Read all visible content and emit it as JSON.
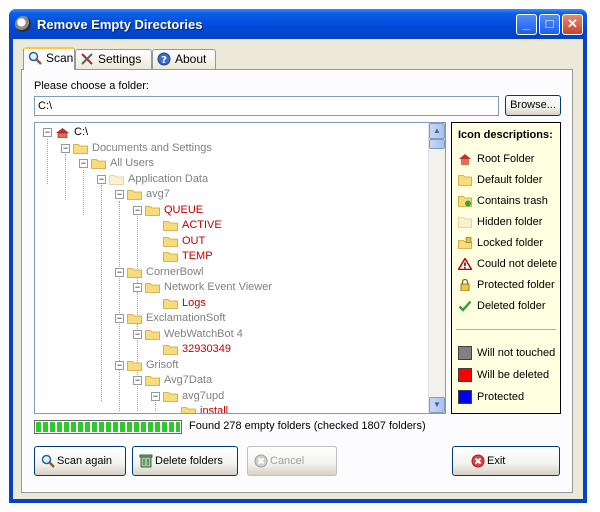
{
  "window": {
    "title": "Remove Empty Directories",
    "controls": {
      "minimize": "_",
      "maximize": "□",
      "close": "✕"
    }
  },
  "tabs": [
    {
      "label": "Scan",
      "icon": "magnifier-icon",
      "active": true
    },
    {
      "label": "Settings",
      "icon": "tools-icon",
      "active": false
    },
    {
      "label": "About",
      "icon": "help-icon",
      "active": false
    }
  ],
  "scan": {
    "folder_label": "Please choose a folder:",
    "folder_value": "C:\\",
    "browse_label": "Browse...",
    "tree": [
      {
        "label": "C:\\",
        "level": 0,
        "color": "black",
        "icon": "root"
      },
      {
        "label": "Documents and Settings",
        "level": 1,
        "color": "gray",
        "icon": "default"
      },
      {
        "label": "All Users",
        "level": 2,
        "color": "gray",
        "icon": "default"
      },
      {
        "label": "Application Data",
        "level": 3,
        "color": "gray",
        "icon": "hidden"
      },
      {
        "label": "avg7",
        "level": 4,
        "color": "gray",
        "icon": "default"
      },
      {
        "label": "QUEUE",
        "level": 5,
        "color": "red",
        "icon": "default"
      },
      {
        "label": "ACTIVE",
        "level": 6,
        "color": "red",
        "icon": "default",
        "leaf": true
      },
      {
        "label": "OUT",
        "level": 6,
        "color": "red",
        "icon": "default",
        "leaf": true
      },
      {
        "label": "TEMP",
        "level": 6,
        "color": "red",
        "icon": "default",
        "leaf": true
      },
      {
        "label": "CornerBowl",
        "level": 4,
        "color": "gray",
        "icon": "default"
      },
      {
        "label": "Network Event Viewer",
        "level": 5,
        "color": "gray",
        "icon": "default"
      },
      {
        "label": "Logs",
        "level": 6,
        "color": "red",
        "icon": "default",
        "leaf": true
      },
      {
        "label": "ExclamationSoft",
        "level": 4,
        "color": "gray",
        "icon": "default"
      },
      {
        "label": "WebWatchBot 4",
        "level": 5,
        "color": "gray",
        "icon": "default"
      },
      {
        "label": "32930349",
        "level": 6,
        "color": "red",
        "icon": "default",
        "leaf": true
      },
      {
        "label": "Grisoft",
        "level": 4,
        "color": "gray",
        "icon": "default"
      },
      {
        "label": "Avg7Data",
        "level": 5,
        "color": "gray",
        "icon": "default"
      },
      {
        "label": "avg7upd",
        "level": 6,
        "color": "gray",
        "icon": "default"
      },
      {
        "label": "install",
        "level": 7,
        "color": "red",
        "icon": "default",
        "leaf": true
      }
    ],
    "legend": {
      "title": "Icon descriptions:",
      "icons": [
        {
          "label": "Root Folder",
          "icon": "root-folder-icon"
        },
        {
          "label": "Default folder",
          "icon": "default-folder-icon"
        },
        {
          "label": "Contains trash",
          "icon": "trash-folder-icon"
        },
        {
          "label": "Hidden folder",
          "icon": "hidden-folder-icon"
        },
        {
          "label": "Locked folder",
          "icon": "locked-folder-icon"
        },
        {
          "label": "Could not delete",
          "icon": "warning-icon"
        },
        {
          "label": "Protected folder",
          "icon": "lock-icon"
        },
        {
          "label": "Deleted folder",
          "icon": "checkmark-icon"
        }
      ],
      "colors": [
        {
          "label": "Will not touched",
          "color": "#808080"
        },
        {
          "label": "Will be deleted",
          "color": "#ff0000"
        },
        {
          "label": "Protected",
          "color": "#0000ff"
        }
      ]
    },
    "progress": 1.0,
    "status": "Found 278 empty folders (checked 1807 folders)",
    "buttons": {
      "scan_again": "Scan again",
      "delete": "Delete folders",
      "cancel": "Cancel",
      "exit": "Exit"
    }
  }
}
